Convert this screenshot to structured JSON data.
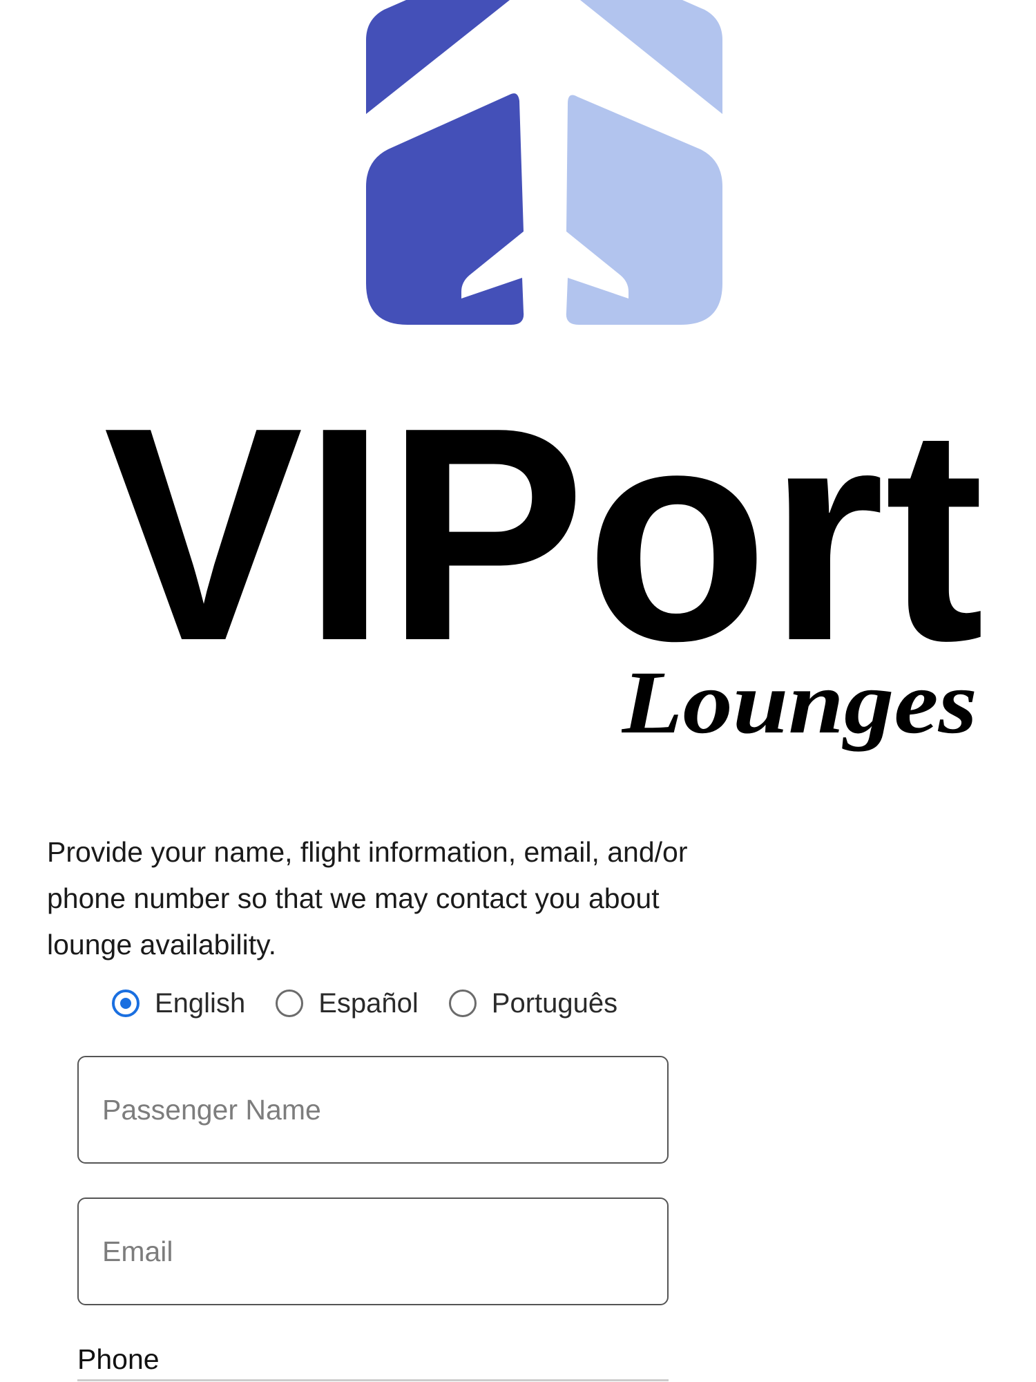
{
  "brand": {
    "wordmark": "VIPort",
    "subtitle": "Lounges",
    "colors": {
      "mark_dark": "#4450b8",
      "mark_light": "#b2c4ee",
      "text": "#000000"
    },
    "logo_icon": "airplane-house-icon"
  },
  "form": {
    "intro": "Provide your name, flight information, email, and/or phone number so that we may contact you about lounge availability.",
    "languages": [
      {
        "label": "English",
        "checked": true
      },
      {
        "label": "Español",
        "checked": false
      },
      {
        "label": "Português",
        "checked": false
      }
    ],
    "passenger_name": {
      "value": "",
      "placeholder": "Passenger Name"
    },
    "email": {
      "value": "",
      "placeholder": "Email"
    },
    "phone_label": "Phone",
    "accent_color": "#1a6fe0"
  }
}
